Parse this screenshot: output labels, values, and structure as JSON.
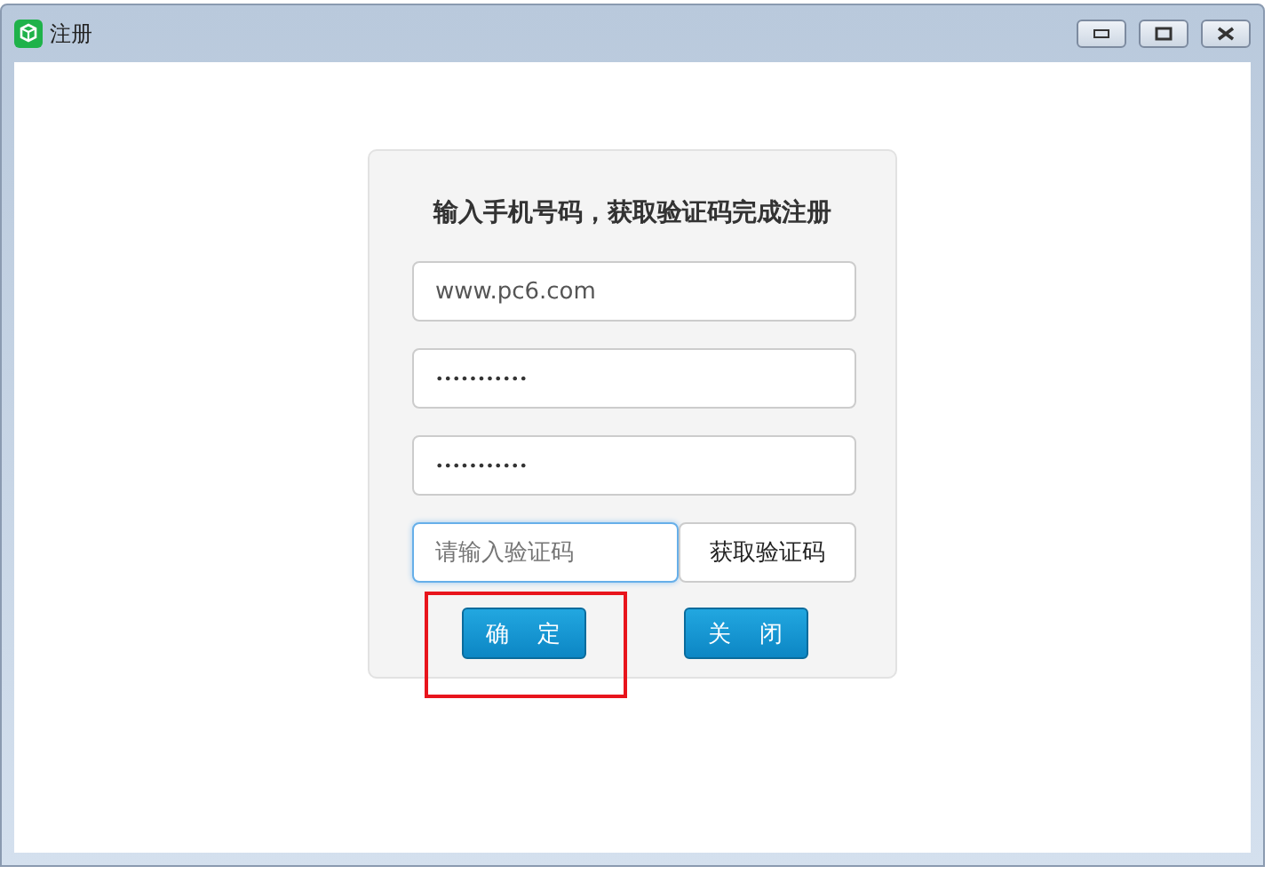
{
  "window": {
    "title": "注册"
  },
  "form": {
    "heading": "输入手机号码，获取验证码完成注册",
    "fields": [
      {
        "kind": "text",
        "value": "www.pc6.com",
        "focused": false
      },
      {
        "kind": "password",
        "value": "•••••••••••",
        "focused": false
      },
      {
        "kind": "password",
        "value": "•••••••••••",
        "focused": false
      }
    ],
    "code_field": {
      "placeholder": "请输入验证码",
      "focused": true
    },
    "code_button": "获取验证码",
    "buttons": [
      {
        "label": "确 定",
        "highlighted": true
      },
      {
        "label": "关 闭",
        "highlighted": false
      }
    ]
  }
}
